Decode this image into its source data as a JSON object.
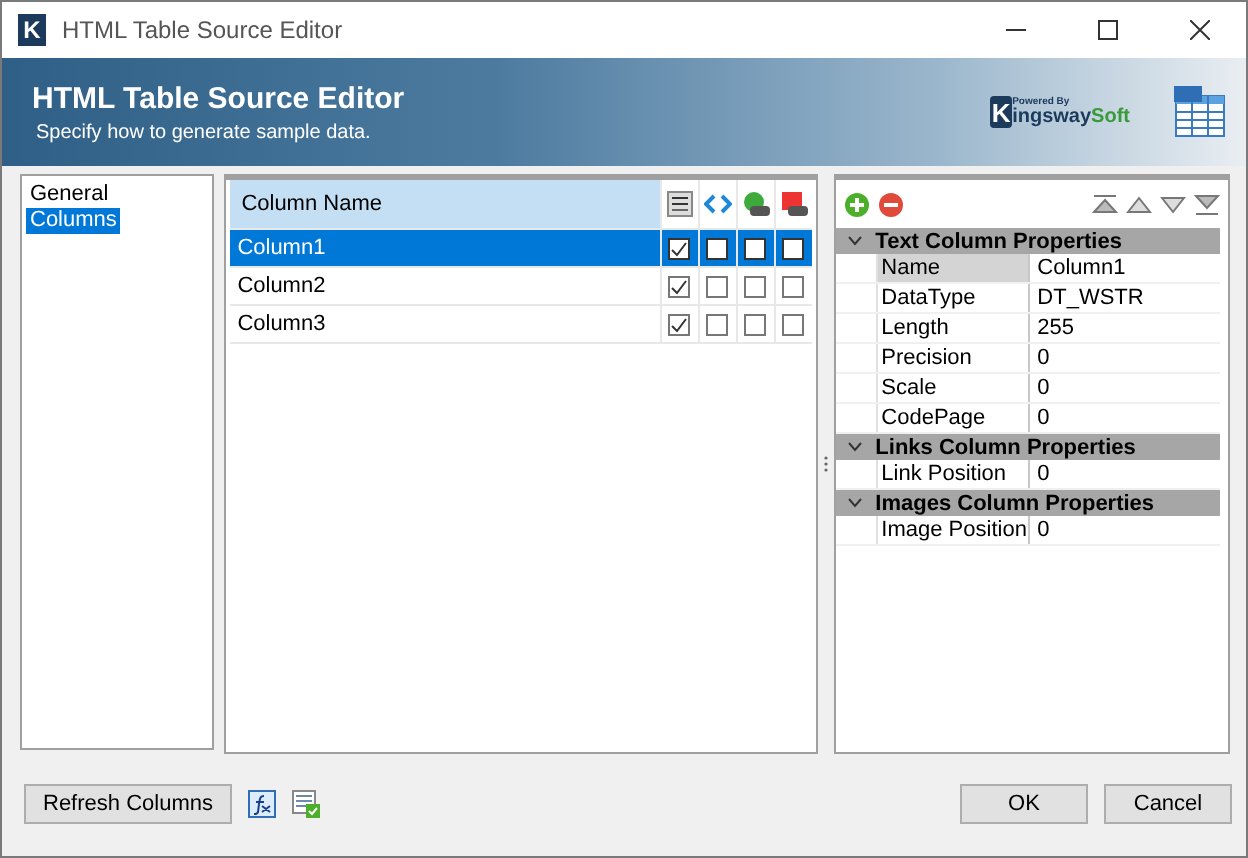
{
  "window": {
    "icon_letter": "K",
    "title": "HTML Table Source Editor"
  },
  "banner": {
    "title": "HTML Table Source Editor",
    "subtitle": "Specify how to generate sample data.",
    "logo": {
      "powered": "Powered By",
      "letter": "K",
      "name": "ingsway",
      "suffix": "Soft"
    }
  },
  "sidebar": {
    "items": [
      {
        "label": "General",
        "selected": false
      },
      {
        "label": "Columns",
        "selected": true
      }
    ]
  },
  "table": {
    "columns": [
      {
        "label": "Column Name",
        "kind": "text"
      },
      {
        "kind": "abc"
      },
      {
        "kind": "code"
      },
      {
        "kind": "link"
      },
      {
        "kind": "image"
      }
    ],
    "rows": [
      {
        "name": "Column1",
        "selected": true,
        "checks": [
          true,
          false,
          false,
          false
        ]
      },
      {
        "name": "Column2",
        "selected": false,
        "checks": [
          true,
          false,
          false,
          false
        ]
      },
      {
        "name": "Column3",
        "selected": false,
        "checks": [
          true,
          false,
          false,
          false
        ]
      }
    ]
  },
  "properties": {
    "groups": [
      {
        "title": "Text Column Properties",
        "expanded": true,
        "rows": [
          {
            "name": "Name",
            "value": "Column1",
            "selected": true
          },
          {
            "name": "DataType",
            "value": "DT_WSTR",
            "selected": false
          },
          {
            "name": "Length",
            "value": "255",
            "selected": false
          },
          {
            "name": "Precision",
            "value": "0",
            "selected": false
          },
          {
            "name": "Scale",
            "value": "0",
            "selected": false
          },
          {
            "name": "CodePage",
            "value": "0",
            "selected": false
          }
        ]
      },
      {
        "title": "Links Column Properties",
        "expanded": true,
        "rows": [
          {
            "name": "Link Position",
            "value": "0",
            "selected": false
          }
        ]
      },
      {
        "title": "Images Column Properties",
        "expanded": true,
        "rows": [
          {
            "name": "Image Position",
            "value": "0",
            "selected": false
          }
        ]
      }
    ]
  },
  "footer": {
    "refresh": "Refresh Columns",
    "ok": "OK",
    "cancel": "Cancel"
  }
}
